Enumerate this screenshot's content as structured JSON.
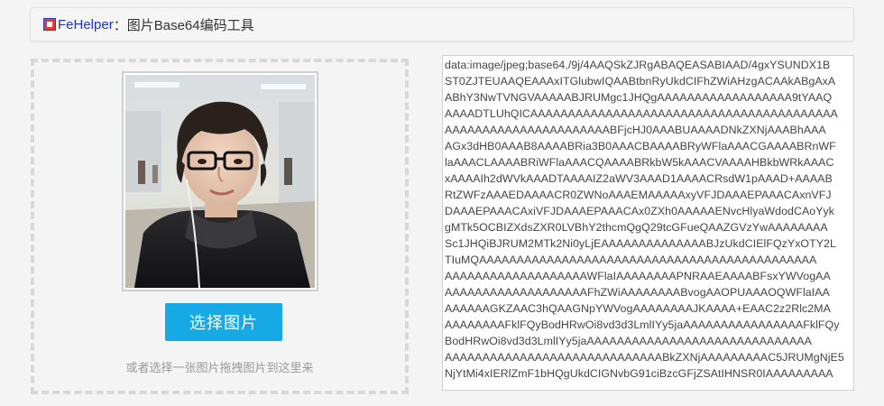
{
  "header": {
    "app_name": "FeHelper",
    "separator": "：",
    "title": "图片Base64编码工具"
  },
  "dropzone": {
    "button_label": "选择图片",
    "hint": "或者选择一张图片拖拽图片到这里来"
  },
  "output": {
    "text": "data:image/jpeg;base64,/9j/4AAQSkZJRgABAQEASABIAAD/4gxYSUNDX1B\nST0ZJTEUAAQEAAAxITGlubwIQAABtbnRyUkdCIFhZWiAHzgACAAkABgAxA\nABhY3NwTVNGVAAAAABJRUMgc1JHQgAAAAAAAAAAAAAAAAAA9tYAAQ\nAAAADTLUhQICAAAAAAAAAAAAAAAAAAAAAAAAAAAAAAAAAAAAAAAAA\nAAAAAAAAAAAAAAAAAAAAAABFjcHJ0AAABUAAAADNkZXNjAAABhAAA\nAGx3dHB0AAAB8AAAABRia3B0AAACBAAAABRyWFlaAAACGAAAABRnWF\nlaAAACLAAAABRiWFlaAAACQAAAABRkbW5kAAACVAAAAHBkbWRkAAAC\nxAAAAIh2dWVkAAADTAAAAIZ2aWV3AAAD1AAAACRsdW1pAAAD+AAAAB\nRtZWFzAAAEDAAAACR0ZWNoAAAEMAAAAAxyVFJDAAAEPAAACAxnVFJ\nDAAAEPAAACAxiVFJDAAAEPAAACAx0ZXh0AAAAAENvcHlyaWdodCAoYyk\ngMTk5OCBIZXdsZXR0LVBhY2thcmQgQ29tcGFueQAAZGVzYwAAAAAAAA\nSc1JHQiBJRUM2MTk2Ni0yLjEAAAAAAAAAAAAAABJzUkdCIElFQzYxOTY2L\nTIuMQAAAAAAAAAAAAAAAAAAAAAAAAAAAAAAAAAAAAAAAAAAAAA\nAAAAAAAAAAAAAAAAAAAWFlaIAAAAAAAAPNRAAEAAAABFsxYWVogAA\nAAAAAAAAAAAAAAAAAAAFhZWiAAAAAAAABvogAAOPUAAAOQWFlaIAA\nAAAAAAGKZAAC3hQAAGNpYWVogAAAAAAAAJKAAAA+EAAC2z2Rlc2MA\nAAAAAAAAFklFQyBodHRwOi8vd3d3LmlIYy5jaAAAAAAAAAAAAAAAAFklFQy\nBodHRwOi8vd3d3LmlIYy5jaAAAAAAAAAAAAAAAAAAAAAAAAAAAAAA\nAAAAAAAAAAAAAAAAAAAAAAAAAAAAABkZXNjAAAAAAAAAC5JRUMgNjE5\nNjYtMi4xIERlZmF1bHQgUkdCIGNvbG91ciBzcGFjZSAtIHNSR0IAAAAAAAAA"
  },
  "colors": {
    "accent": "#17a8e6",
    "brand_blue": "#1a33d6",
    "logo_red": "#e53935"
  },
  "icons": {
    "logo": "fehelper-logo-icon"
  }
}
